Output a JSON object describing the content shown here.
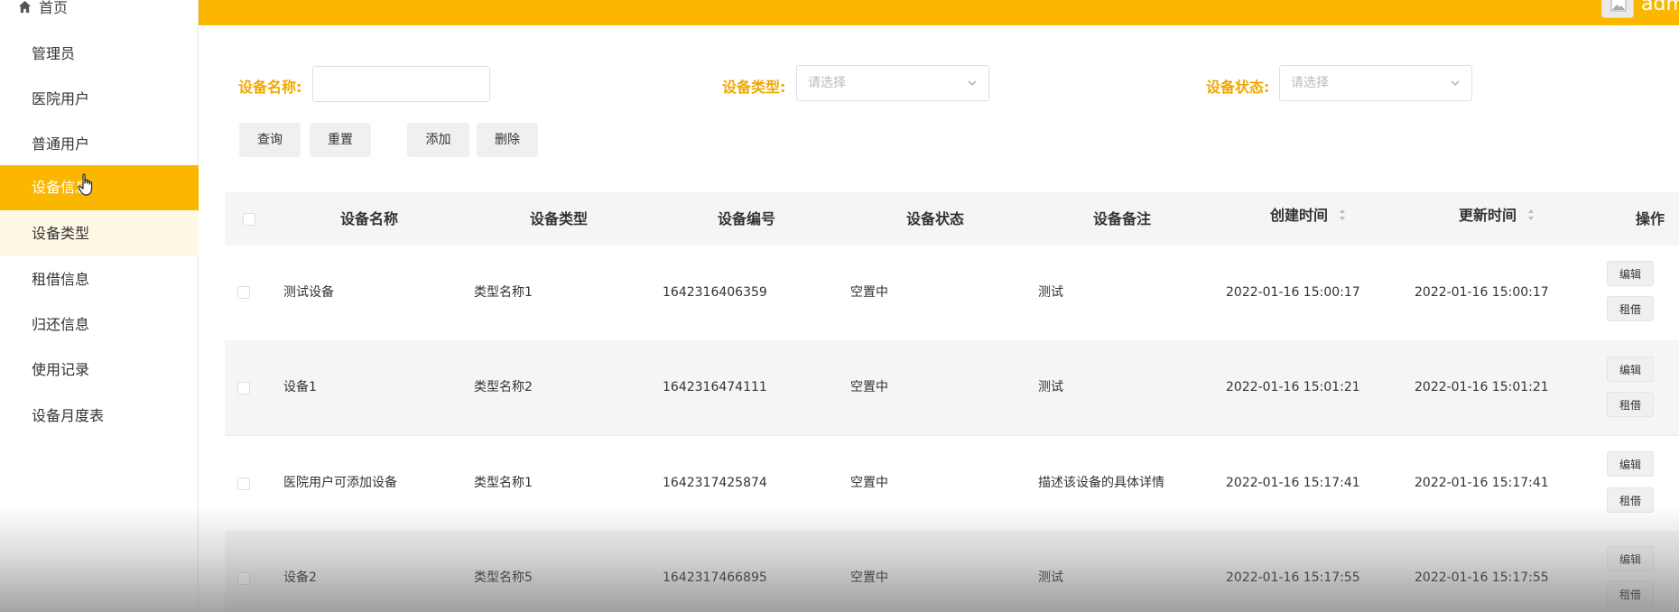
{
  "sidebar": {
    "home_label": "首页",
    "items": [
      {
        "label": "管理员"
      },
      {
        "label": "医院用户"
      },
      {
        "label": "普通用户"
      },
      {
        "label": "设备信息"
      },
      {
        "label": "设备类型"
      },
      {
        "label": "租借信息"
      },
      {
        "label": "归还信息"
      },
      {
        "label": "使用记录"
      },
      {
        "label": "设备月度表"
      }
    ]
  },
  "header": {
    "username": "admin",
    "accent_color": "#fbb700"
  },
  "search": {
    "name_label": "设备名称:",
    "name_value": "",
    "type_label": "设备类型:",
    "type_placeholder": "请选择",
    "status_label": "设备状态:",
    "status_placeholder": "请选择"
  },
  "toolbar": {
    "query": "查询",
    "reset": "重置",
    "add": "添加",
    "delete": "删除"
  },
  "table": {
    "headers": [
      "设备名称",
      "设备类型",
      "设备编号",
      "设备状态",
      "设备备注",
      "创建时间",
      "更新时间",
      "操作"
    ],
    "rows": [
      {
        "name": "测试设备",
        "type": "类型名称1",
        "code": "1642316406359",
        "status": "空置中",
        "remark": "测试",
        "created": "2022-01-16 15:00:17",
        "updated": "2022-01-16 15:00:17"
      },
      {
        "name": "设备1",
        "type": "类型名称2",
        "code": "1642316474111",
        "status": "空置中",
        "remark": "测试",
        "created": "2022-01-16 15:01:21",
        "updated": "2022-01-16 15:01:21"
      },
      {
        "name": "医院用户可添加设备",
        "type": "类型名称1",
        "code": "1642317425874",
        "status": "空置中",
        "remark": "描述该设备的具体详情",
        "created": "2022-01-16 15:17:41",
        "updated": "2022-01-16 15:17:41"
      },
      {
        "name": "设备2",
        "type": "类型名称5",
        "code": "1642317466895",
        "status": "空置中",
        "remark": "测试",
        "created": "2022-01-16 15:17:55",
        "updated": "2022-01-16 15:17:55"
      }
    ],
    "edit_label": "编辑",
    "rent_label": "租借"
  }
}
